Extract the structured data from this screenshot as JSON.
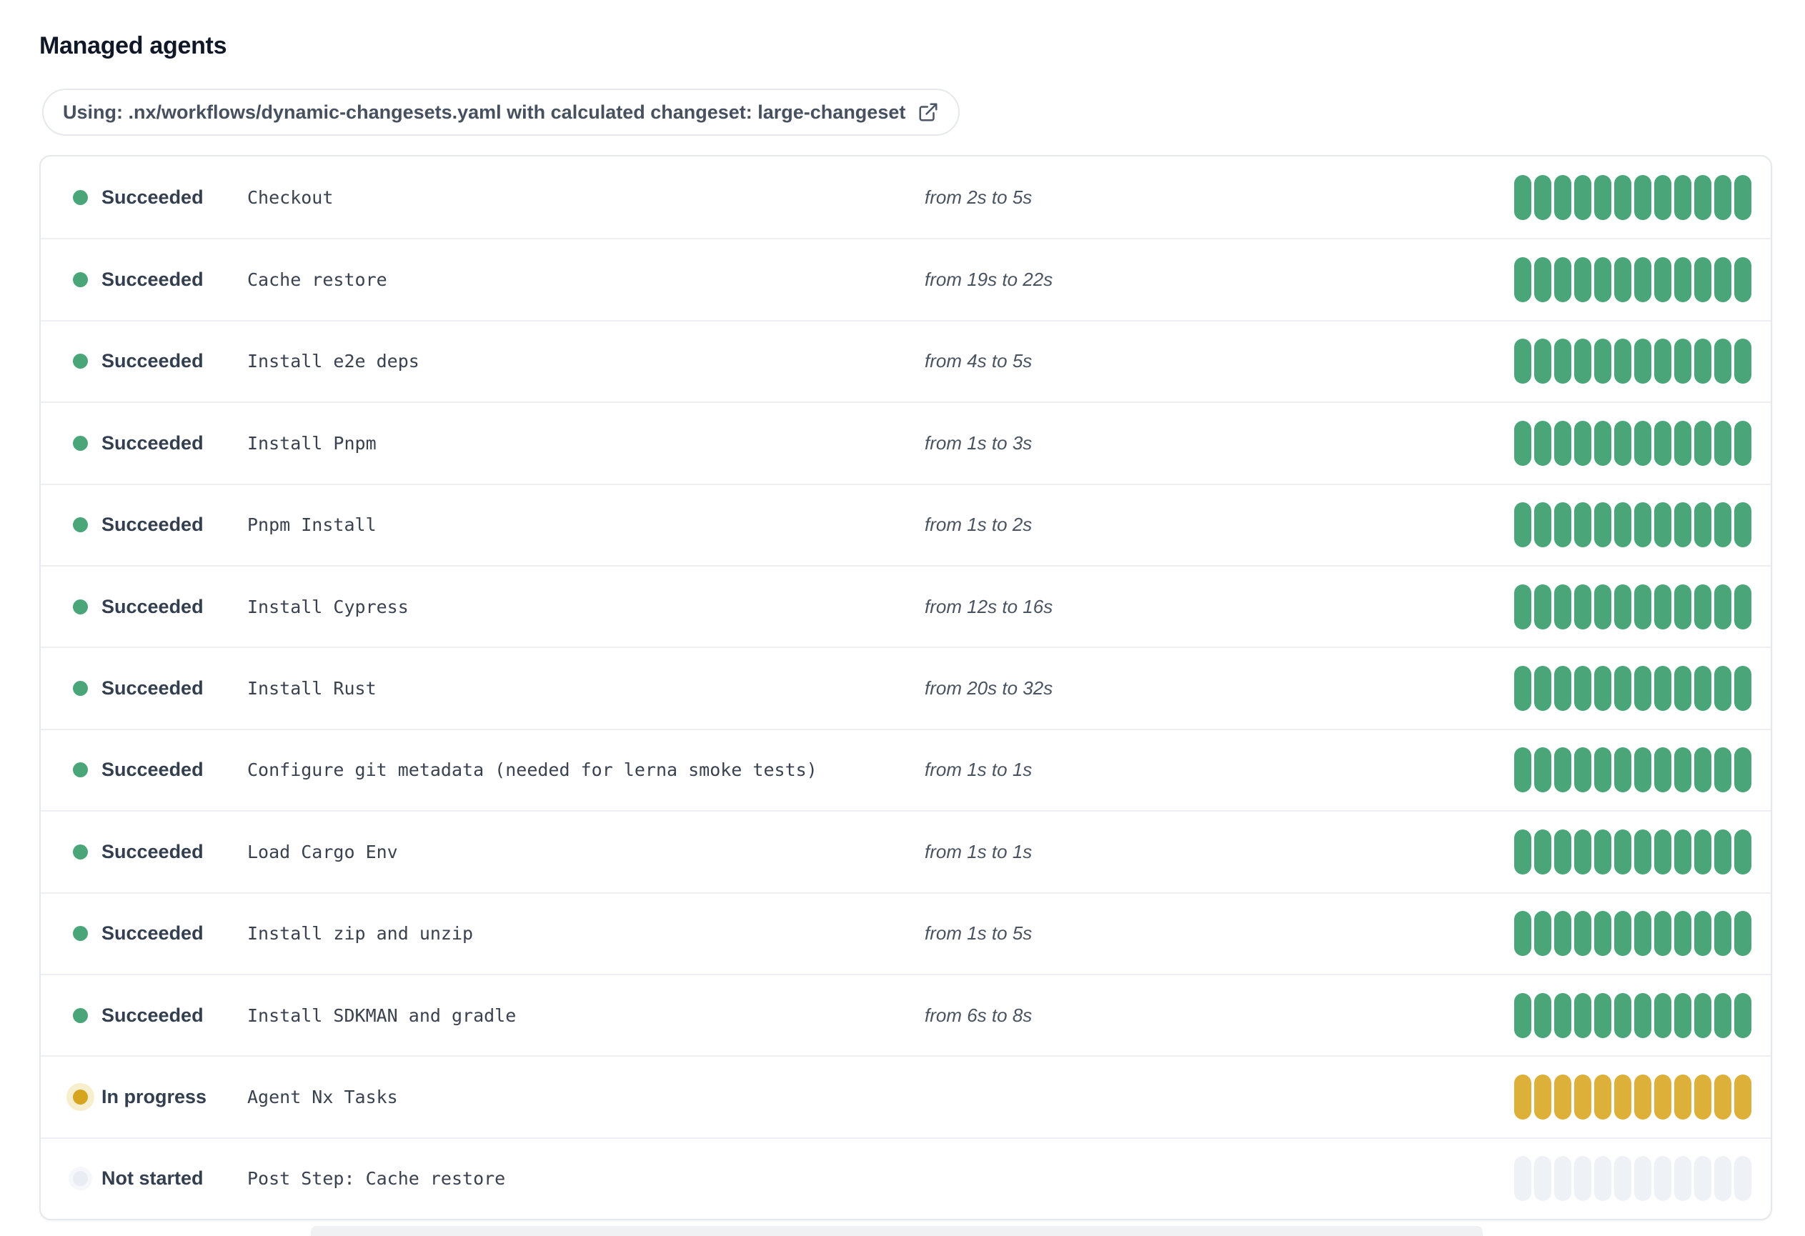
{
  "page": {
    "title": "Managed agents"
  },
  "workflow_banner": {
    "text": "Using: .nx/workflows/dynamic-changesets.yaml with calculated changeset: large-changeset",
    "icon": "external-link-icon"
  },
  "colors": {
    "succeeded": "#4aa678",
    "in_progress_bar": "#ddb03a",
    "in_progress_dot": "#d7a41f",
    "in_progress_halo": "#f7eecd",
    "not_started": "#eef2f6",
    "title_text": "#101828",
    "status_text": "#333e4f",
    "border": "#e5e8ec"
  },
  "agents": {
    "bar_segments": 12,
    "rows": [
      {
        "status": "Succeeded",
        "status_key": "succeeded",
        "step": "Checkout",
        "duration": "from 2s to 5s"
      },
      {
        "status": "Succeeded",
        "status_key": "succeeded",
        "step": "Cache restore",
        "duration": "from 19s to 22s"
      },
      {
        "status": "Succeeded",
        "status_key": "succeeded",
        "step": "Install e2e deps",
        "duration": "from 4s to 5s"
      },
      {
        "status": "Succeeded",
        "status_key": "succeeded",
        "step": "Install Pnpm",
        "duration": "from 1s to 3s"
      },
      {
        "status": "Succeeded",
        "status_key": "succeeded",
        "step": "Pnpm Install",
        "duration": "from 1s to 2s"
      },
      {
        "status": "Succeeded",
        "status_key": "succeeded",
        "step": "Install Cypress",
        "duration": "from 12s to 16s"
      },
      {
        "status": "Succeeded",
        "status_key": "succeeded",
        "step": "Install Rust",
        "duration": "from 20s to 32s"
      },
      {
        "status": "Succeeded",
        "status_key": "succeeded",
        "step": "Configure git metadata (needed for lerna smoke tests)",
        "duration": "from 1s to 1s"
      },
      {
        "status": "Succeeded",
        "status_key": "succeeded",
        "step": "Load Cargo Env",
        "duration": "from 1s to 1s"
      },
      {
        "status": "Succeeded",
        "status_key": "succeeded",
        "step": "Install zip and unzip",
        "duration": "from 1s to 5s"
      },
      {
        "status": "Succeeded",
        "status_key": "succeeded",
        "step": "Install SDKMAN and gradle",
        "duration": "from 6s to 8s"
      },
      {
        "status": "In progress",
        "status_key": "in-progress",
        "step": "Agent Nx Tasks",
        "duration": ""
      },
      {
        "status": "Not started",
        "status_key": "not-started",
        "step": "Post Step: Cache restore",
        "duration": ""
      }
    ]
  }
}
